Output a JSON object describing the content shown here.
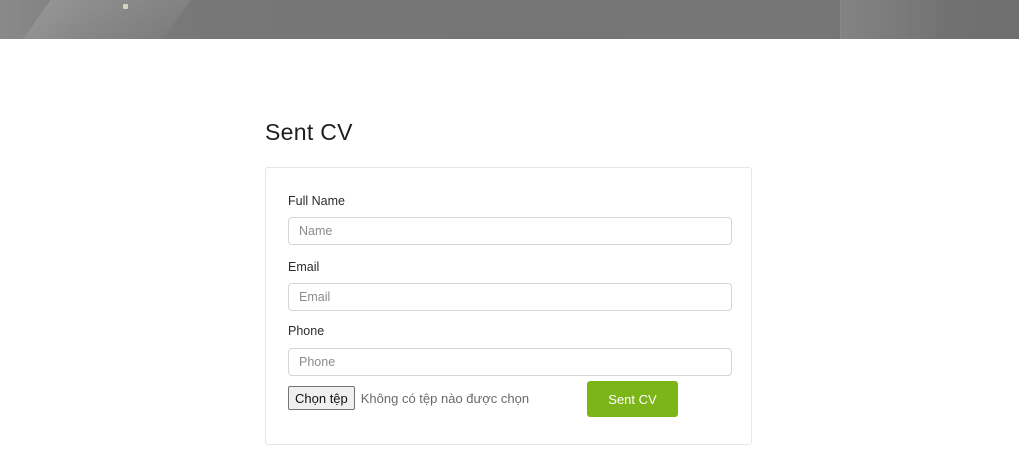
{
  "page": {
    "title": "Sent CV"
  },
  "form": {
    "full_name": {
      "label": "Full Name",
      "placeholder": "Name",
      "value": ""
    },
    "email": {
      "label": "Email",
      "placeholder": "Email",
      "value": ""
    },
    "phone": {
      "label": "Phone",
      "placeholder": "Phone",
      "value": ""
    },
    "file": {
      "button_label": "Chọn tệp",
      "status_text": "Không có tệp nào được chọn"
    },
    "submit_label": "Sent CV"
  },
  "colors": {
    "accent": "#7cb518",
    "banner": "#777777"
  }
}
